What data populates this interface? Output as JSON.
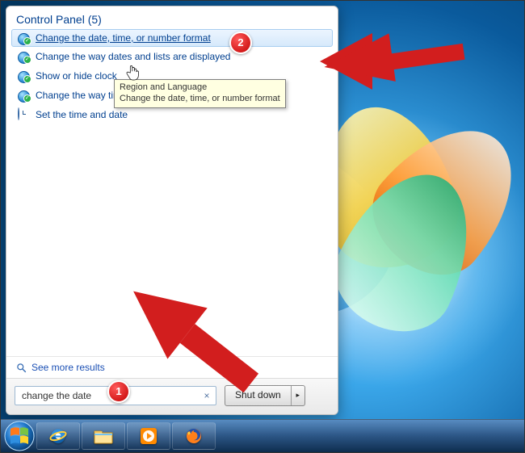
{
  "wallpaper": "windows-7-default",
  "menu": {
    "header": "Control Panel (5)",
    "items": [
      {
        "label": "Change the date, time, or number format",
        "icon": "region",
        "selected": true
      },
      {
        "label": "Change the way dates and lists are displayed",
        "icon": "region",
        "selected": false
      },
      {
        "label": "Show or hide clock",
        "icon": "region",
        "selected": false
      },
      {
        "label": "Change the way time is displayed",
        "icon": "region",
        "selected": false
      },
      {
        "label": "Set the time and date",
        "icon": "clock",
        "selected": false
      }
    ],
    "see_more": "See more results"
  },
  "search": {
    "value": "change the date",
    "clear_glyph": "×"
  },
  "shutdown": {
    "label": "Shut down",
    "arrow_glyph": "▸"
  },
  "tooltip": {
    "title": "Region and Language",
    "subtitle": "Change the date, time, or number format"
  },
  "annotations": {
    "badge1": "1",
    "badge2": "2"
  }
}
